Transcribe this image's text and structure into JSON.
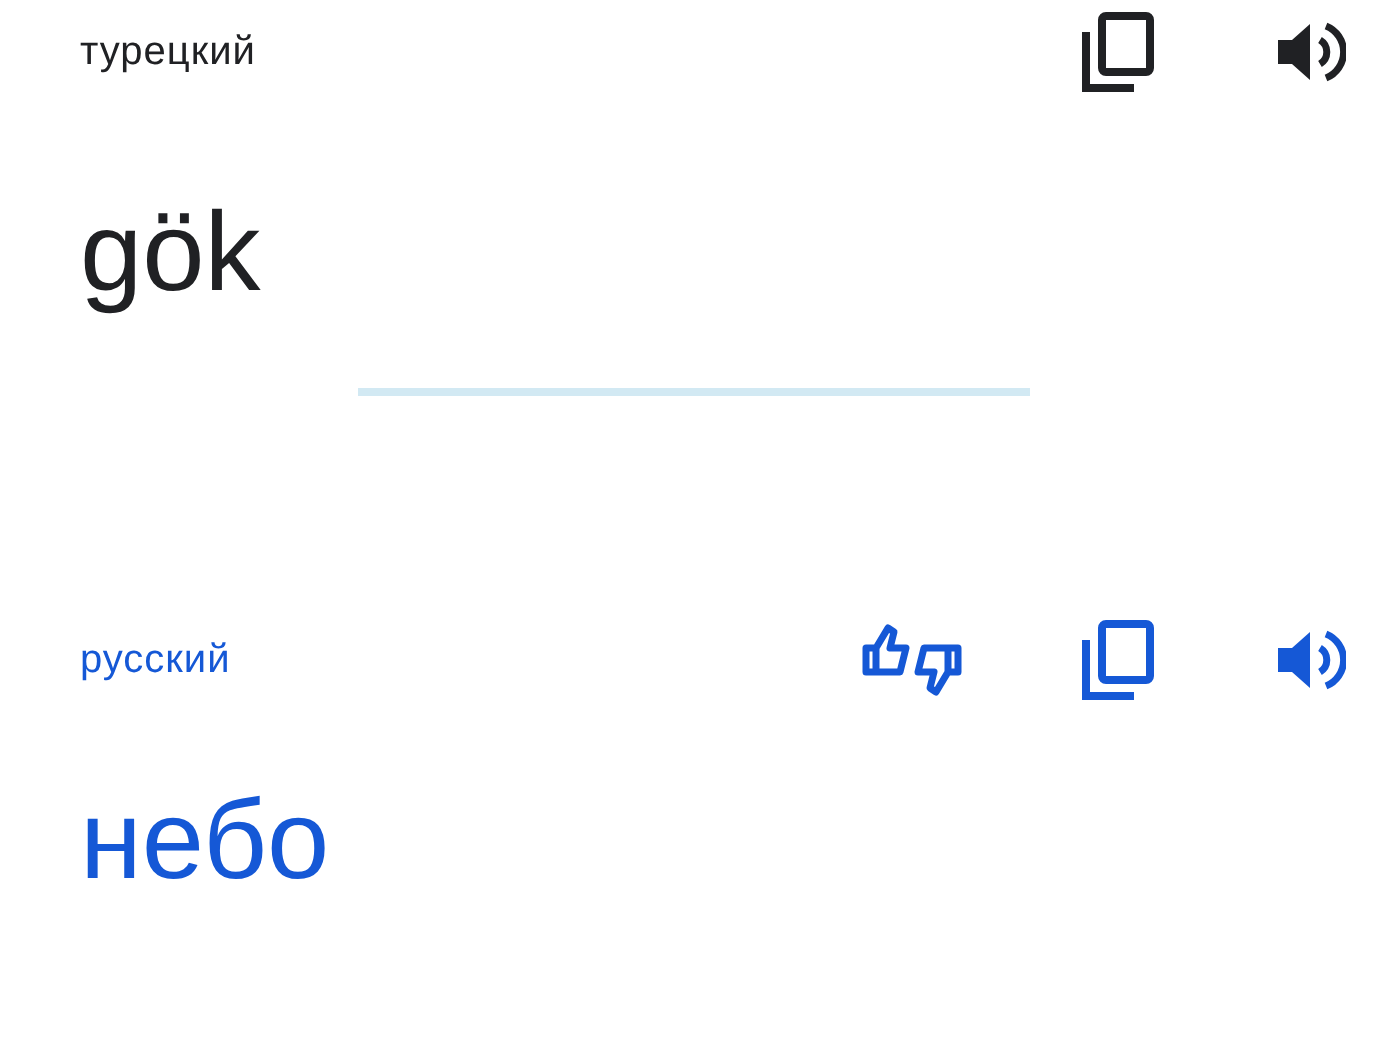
{
  "source": {
    "language": "турецкий",
    "text": "gök"
  },
  "target": {
    "language": "русский",
    "text": "небо"
  }
}
